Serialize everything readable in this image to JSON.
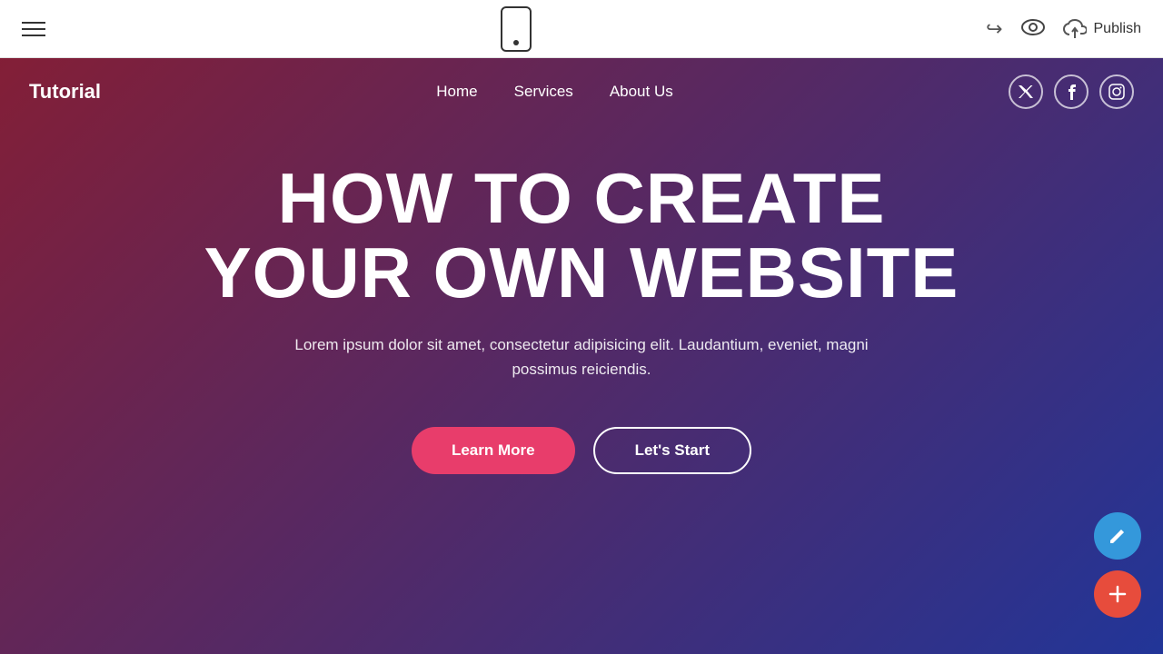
{
  "toolbar": {
    "hamburger_label": "menu",
    "phone_label": "mobile preview",
    "undo_label": "undo",
    "preview_label": "preview",
    "publish_label": "Publish"
  },
  "site": {
    "logo": "Tutorial",
    "nav": {
      "links": [
        {
          "id": "home",
          "label": "Home"
        },
        {
          "id": "services",
          "label": "Services"
        },
        {
          "id": "about",
          "label": "About Us"
        }
      ]
    },
    "social": [
      {
        "id": "twitter",
        "symbol": "𝕏"
      },
      {
        "id": "facebook",
        "symbol": "f"
      },
      {
        "id": "instagram",
        "symbol": "📷"
      }
    ],
    "hero": {
      "title_line1": "HOW TO CREATE",
      "title_line2": "YOUR OWN WEBSITE",
      "subtitle": "Lorem ipsum dolor sit amet, consectetur adipisicing elit. Laudantium, eveniet, magni possimus reiciendis.",
      "btn_learn_more": "Learn More",
      "btn_lets_start": "Let's Start"
    }
  },
  "colors": {
    "gradient_left": "#a01428",
    "gradient_right": "#1e32a0",
    "btn_pink": "#e83d6b",
    "fab_blue": "#3498db",
    "fab_red": "#e74c3c"
  }
}
